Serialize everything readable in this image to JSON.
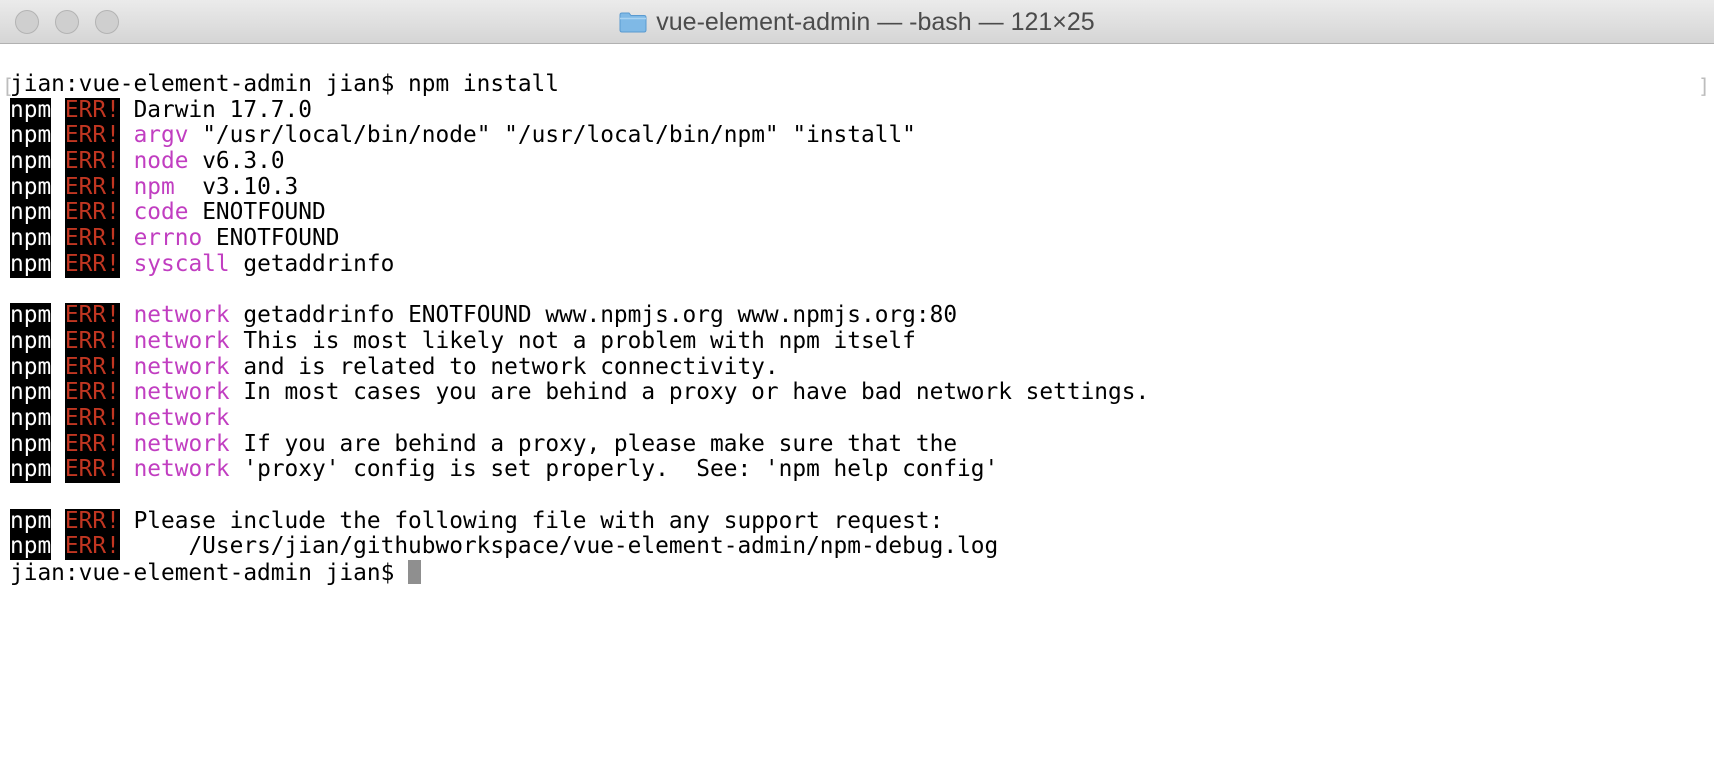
{
  "window": {
    "title": "vue-element-admin — -bash — 121×25",
    "folder_icon": "folder-icon"
  },
  "terminal": {
    "prompt": "jian:vue-element-admin jian$ ",
    "command": "npm install",
    "npm_label": "npm",
    "err_label": "ERR!",
    "lines": [
      {
        "key": "",
        "text": "Darwin 17.7.0"
      },
      {
        "key": "argv",
        "text": " \"/usr/local/bin/node\" \"/usr/local/bin/npm\" \"install\""
      },
      {
        "key": "node",
        "text": " v6.3.0"
      },
      {
        "key": "npm",
        "text": "  v3.10.3"
      },
      {
        "key": "code",
        "text": " ENOTFOUND"
      },
      {
        "key": "errno",
        "text": " ENOTFOUND"
      },
      {
        "key": "syscall",
        "text": " getaddrinfo"
      },
      {
        "blank": true
      },
      {
        "key": "network",
        "text": " getaddrinfo ENOTFOUND www.npmjs.org www.npmjs.org:80"
      },
      {
        "key": "network",
        "text": " This is most likely not a problem with npm itself"
      },
      {
        "key": "network",
        "text": " and is related to network connectivity."
      },
      {
        "key": "network",
        "text": " In most cases you are behind a proxy or have bad network settings."
      },
      {
        "key": "network",
        "text": ""
      },
      {
        "key": "network",
        "text": " If you are behind a proxy, please make sure that the"
      },
      {
        "key": "network",
        "text": " 'proxy' config is set properly.  See: 'npm help config'"
      },
      {
        "blank": true
      },
      {
        "key": "",
        "text": "Please include the following file with any support request:"
      },
      {
        "key": "",
        "text": "    /Users/jian/githubworkspace/vue-element-admin/npm-debug.log"
      }
    ],
    "final_prompt": "jian:vue-element-admin jian$ "
  },
  "colors": {
    "err": "#c23621",
    "key": "#c13ec1",
    "tag_bg": "#000000"
  }
}
